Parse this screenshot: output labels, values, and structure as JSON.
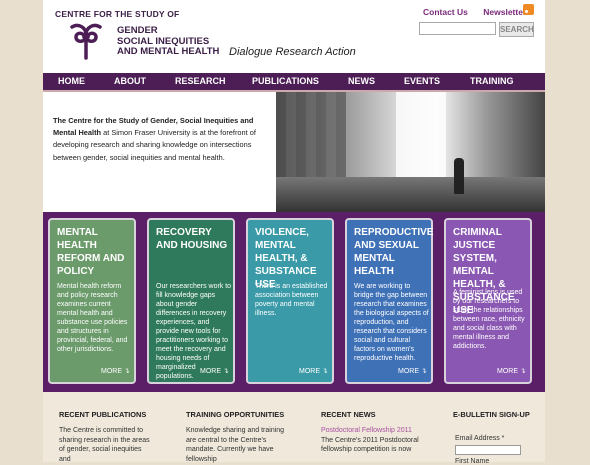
{
  "header": {
    "top_label": "CENTRE FOR THE STUDY OF",
    "logo_lines": [
      "GENDER",
      "SOCIAL INEQUITIES",
      "AND MENTAL HEALTH"
    ],
    "tagline": "Dialogue Research Action",
    "links": [
      "Contact Us",
      "Newsletter"
    ],
    "search": {
      "placeholder": "",
      "button": "SEARCH"
    }
  },
  "nav": [
    "HOME",
    "ABOUT",
    "RESEARCH",
    "PUBLICATIONS",
    "NEWS",
    "EVENTS",
    "TRAINING"
  ],
  "intro": {
    "bold": "The Centre for the Study of Gender, Social Inequities and Mental Health",
    "text": " at Simon Fraser University is at the forefront of developing research and sharing knowledge on intersections between gender, social inequities and mental health."
  },
  "cards": [
    {
      "title": "MENTAL HEALTH REFORM AND POLICY",
      "body": "Mental health reform and policy research examines current mental health and substance use policies and structures in provincial, federal, and other jurisdictions.",
      "more": "MORE ↴",
      "color": "#6b9a6b"
    },
    {
      "title": "RECOVERY AND HOUSING",
      "body": "Our researchers work to fill knowledge gaps about gender differences in recovery experiences, and provide new tools for practitioners working to meet the recovery and housing needs of marginalized populations.",
      "more": "MORE ↴",
      "color": "#2f7a5c"
    },
    {
      "title": "VIOLENCE, MENTAL HEALTH, & SUBSTANCE USE",
      "body": "There is an established association between poverty and mental illness.",
      "more": "MORE ↴",
      "color": "#3a9aa7"
    },
    {
      "title": "REPRODUCTIVE AND SEXUAL MENTAL HEALTH",
      "body": "We are working to bridge the gap between research that examines the biological aspects of reproduction, and research that considers social and cultural factors on women's reproductive health.",
      "more": "MORE ↴",
      "color": "#3f71b7"
    },
    {
      "title": "CRIMINAL JUSTICE SYSTEM, MENTAL HEALTH, & SUBSTANCE USE",
      "body": "A feminist lens is used by our researchers to study the relationships between race, ethnicity and social class with mental illness and addictions.",
      "more": "MORE ↴",
      "color": "#8a58b2"
    }
  ],
  "footer": {
    "publications": {
      "title": "RECENT PUBLICATIONS",
      "text": "The Centre is committed to sharing research in the areas of gender, social inequities and"
    },
    "training": {
      "title": "TRAINING OPPORTUNITIES",
      "text": "Knowledge sharing and training are central to the Centre's mandate. Currently we have fellowship"
    },
    "news": {
      "title": "RECENT NEWS",
      "link": "Postdoctoral Fellowship 2011",
      "text": "The Centre's 2011 Postdoctoral fellowship competition is now"
    },
    "ebulletin": {
      "title": "E-BULLETIN SIGN-UP",
      "email_label": "Email Address *",
      "name_label": "First Name"
    }
  }
}
